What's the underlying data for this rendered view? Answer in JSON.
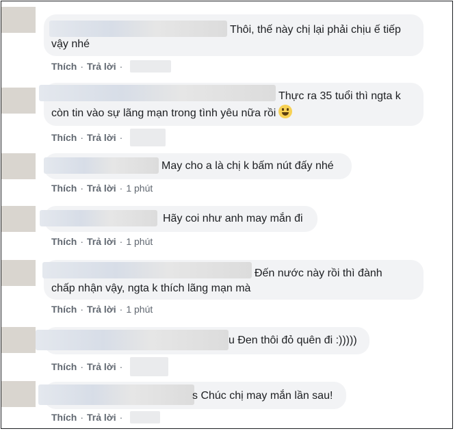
{
  "actions": {
    "like": "Thích",
    "reply": "Trả lời",
    "sep": "·"
  },
  "comments": [
    {
      "lines": [
        "Thôi, thế này chị lại phải chịu ế tiếp",
        "vậy nhé"
      ],
      "time": ""
    },
    {
      "lines": [
        "Thực ra 35 tuổi thì ngta k",
        "còn tin vào sự lãng mạn trong tình yêu nữa rồi"
      ],
      "time": "",
      "emoji": "smiling-face-icon"
    },
    {
      "lines": [
        "May cho a là chị k bấm nút đấy nhé"
      ],
      "time": "1 phút"
    },
    {
      "lines": [
        "Hãy coi như anh may mắn đi"
      ],
      "time": "1 phút"
    },
    {
      "lines": [
        "Đến nước này rồi thì đành",
        "chấp nhận vậy, ngta k thích lãng mạn mà"
      ],
      "time": "1 phút"
    },
    {
      "lines": [
        "u Đen thôi đỏ quên đi :)))))"
      ],
      "time": ""
    },
    {
      "lines": [
        "s Chúc chị may mắn lần sau!"
      ],
      "time": ""
    }
  ]
}
